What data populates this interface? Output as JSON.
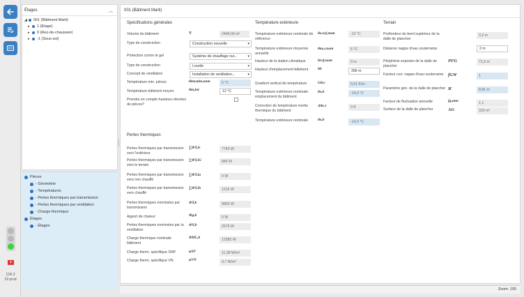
{
  "rail": {
    "back_icon": "arrow-left-icon",
    "list_icon": "checklist-icon",
    "report_icon": "id-card-icon",
    "flag_icon": "swiss-flag-icon",
    "flag_symbol": "+",
    "version": "12A.3",
    "build": "19 prod",
    "accent": "#3a7fc1"
  },
  "tree": {
    "header": "Étages",
    "nodes": [
      {
        "label": "001 (Bâtiment Marti)",
        "level": 0,
        "expanded": true
      },
      {
        "label": "1 (Etage)",
        "level": 1,
        "expanded": false
      },
      {
        "label": "0 (Rez-de-chaussée)",
        "level": 1,
        "expanded": false
      },
      {
        "label": "-1 (Sous-sol)",
        "level": 1,
        "expanded": false
      }
    ]
  },
  "nav": {
    "pieces": "Pièces",
    "items": [
      "- Géométrie",
      "- Températures",
      "- Pertes thermiques par transmission",
      "- Pertes thermiques par ventilation",
      "- Charge thermique"
    ],
    "etages": "Étages",
    "etages_items": [
      "- Étages"
    ]
  },
  "main": {
    "title": "001 (Bâtiment Marti)"
  },
  "general": {
    "title": "Spécifications générales",
    "volume": {
      "label": "Volume du bâtiment",
      "symbol": "V",
      "value": "2404,09 m³"
    },
    "construction": {
      "label": "Type de construction",
      "value": "Construction nouvelle"
    },
    "gel": {
      "label": "Protection contre le gel",
      "value": "Système de chauffage nur..."
    },
    "type_construction": {
      "label": "Type de construction",
      "value": "Lourde"
    },
    "ventilation": {
      "label": "Concept de ventilation",
      "value": "Installation de ventilation..."
    },
    "temp_pieces": {
      "label": "Température min. pièces",
      "symbol": "θint,min,nom",
      "value": "5 °C"
    },
    "temp_moyen": {
      "label": "Température bâtiment moyen",
      "symbol": "θm,int",
      "value": "12 °C"
    },
    "hauteur": {
      "label": "Prendre en compte hauteurs élevées de pièces?"
    }
  },
  "exterior": {
    "title": "Température extérieure",
    "rows": [
      {
        "label": "Température extérieure nominale de référence",
        "symbol": "θe,ref,nom",
        "value": "-12 °C"
      },
      {
        "label": "Température extérieure moyenne annuelle",
        "symbol": "θm,e,nom",
        "value": "6 °C"
      },
      {
        "label": "Hauteur de la station climatique",
        "symbol": "href,nom",
        "value": "0 m"
      },
      {
        "label": "Hauteur d'emplacement bâtiment",
        "symbol": "hb",
        "value": "396 m"
      },
      {
        "label": "Gradient vertical de température",
        "symbol": "Gθ,e",
        "value": "0,01 K/m"
      },
      {
        "label": "Température extérieure nominale emplacement du bâtiment",
        "symbol": "θe,b",
        "value": "-14,0 °C"
      },
      {
        "label": "Correction de température inertie thermique du bâtiment",
        "symbol": "Δθe,τ",
        "value": "0 K"
      },
      {
        "label": "Température extérieure nominale",
        "symbol": "θe,b",
        "value": "-14,0 °C"
      }
    ]
  },
  "terrain": {
    "title": "Terrain",
    "rows": [
      {
        "label": "Profondeur du bord supérieur de la dalle de plancher",
        "symbol": "",
        "value": "3,2 m"
      },
      {
        "label": "Distance nappe d'eau souterraine",
        "symbol": "",
        "value": "2 m"
      },
      {
        "label": "Périphérie exposée de la dalle de plancher",
        "symbol": "PFG",
        "value": "71,5 m"
      },
      {
        "label": "Facteur corr. nappe d'eau souterraine",
        "symbol": "fGW",
        "value": "1"
      },
      {
        "label": "Paramètre géo. de la dalle de plancher",
        "symbol": "B'",
        "value": "8,81 m"
      },
      {
        "label": "Facteur de fluctuation annuelle",
        "symbol": "fg,ann",
        "value": "1,1"
      },
      {
        "label": "Surface de la dalle de plancher",
        "symbol": "AG",
        "value": "315 m²"
      }
    ]
  },
  "losses": {
    "title": "Pertes thermiques",
    "rows": [
      {
        "label": "Pertes thermiques par transmission vers l'extérieur",
        "symbol": "∑ΦT,ie",
        "value": "7743 W"
      },
      {
        "label": "Pertes thermiques par transmission vers le terrain",
        "symbol": "∑ΦT,iG",
        "value": "845 W"
      },
      {
        "label": "Pertes thermiques par transmission vers non chauffé",
        "symbol": "∑ΦT,iu",
        "value": "0 W"
      },
      {
        "label": "Pertes thermiques par transmission vers chauffé",
        "symbol": "∑ΦT,ih",
        "value": "1216 W"
      },
      {
        "label": "Pertes thermiques nominales par transmission",
        "symbol": "ΦT,b",
        "value": "9803 W"
      },
      {
        "label": "Apport de chaleur",
        "symbol": "Φg,b",
        "value": "0 W"
      },
      {
        "label": "Pertes thermiques nominales par la ventilation",
        "symbol": "ΦV,b",
        "value": "2579 W"
      },
      {
        "label": "Charge thermique nominale bâtiment",
        "symbol": "ΦHL,b",
        "value": "12382 W"
      },
      {
        "label": "Charge therm. spécifique SNP",
        "symbol": "φSP",
        "value": "11,38 W/m²"
      },
      {
        "label": "Charge therm. spécifique VN",
        "symbol": "φVN",
        "value": "4,7 W/m³"
      }
    ]
  },
  "status": {
    "zoom": "Zoom: 100"
  }
}
